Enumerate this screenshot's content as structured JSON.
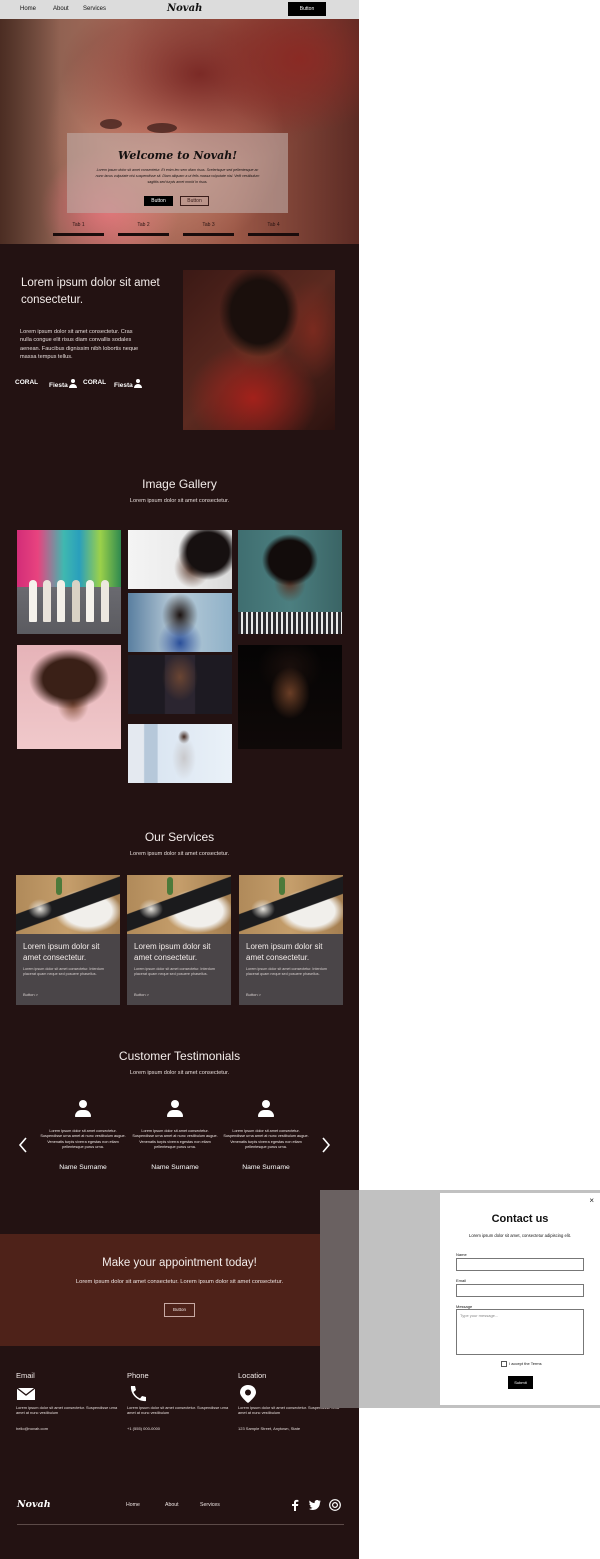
{
  "nav": {
    "links": [
      "Home",
      "About",
      "Services"
    ],
    "logo": "Novah",
    "button": "Button"
  },
  "hero": {
    "title": "Welcome to Novah!",
    "body": "Lorem ipsum dolor sit amet consectetur. Et enim leo sem diam risus. Scelerisque sed pellentesque ac nunc lacus vulputate nisi suspendisse sit. Diam aliquam a ut felis massa vulputate nisi. Velit vestibulum sagittis sed turpis amet morbi in risus.",
    "button_primary": "Button",
    "button_secondary": "Button",
    "tabs": [
      "Tab 1",
      "Tab 2",
      "Tab 3",
      "Tab 4"
    ]
  },
  "intro": {
    "title": "Lorem ipsum dolor sit amet consectetur.",
    "body": "Lorem ipsum dolor sit amet consectetur. Cras nulla congue elit risus diam convallis sodales aenean. Faucibus dignissim nibh lobortis neque massa tempus tellus.",
    "chips": [
      "CORAL",
      "Fiesta",
      "CORAL",
      "Fiesta"
    ]
  },
  "gallery": {
    "title": "Image Gallery",
    "subtitle": "Lorem ipsum dolor sit amet consectetur."
  },
  "services": {
    "title": "Our Services",
    "subtitle": "Lorem ipsum dolor sit amet consectetur.",
    "cards": [
      {
        "title": "Lorem ipsum dolor sit amet consectetur.",
        "body": "Lorem ipsum dolor sit amet consectetur. Interdum placerat quam neque sed posuere phasellus.",
        "link": "Button >"
      },
      {
        "title": "Lorem ipsum dolor sit amet consectetur.",
        "body": "Lorem ipsum dolor sit amet consectetur. Interdum placerat quam neque sed posuere phasellus.",
        "link": "Button >"
      },
      {
        "title": "Lorem ipsum dolor sit amet consectetur.",
        "body": "Lorem ipsum dolor sit amet consectetur. Interdum placerat quam neque sed posuere phasellus.",
        "link": "Button >"
      }
    ]
  },
  "testimonials": {
    "title": "Customer Testimonials",
    "subtitle": "Lorem ipsum dolor sit amet consectetur.",
    "items": [
      {
        "quote": "Lorem ipsum dolor sit amet consectetur. Suspendisse urna amet at nunc vestibulum augue. Venenatis turpis viverra egestas non etiam pellentesque purus urna.",
        "name": "Name Surname"
      },
      {
        "quote": "Lorem ipsum dolor sit amet consectetur. Suspendisse urna amet at nunc vestibulum augue. Venenatis turpis viverra egestas non etiam pellentesque purus urna.",
        "name": "Name Surname"
      },
      {
        "quote": "Lorem ipsum dolor sit amet consectetur. Suspendisse urna amet at nunc vestibulum augue. Venenatis turpis viverra egestas non etiam pellentesque purus urna.",
        "name": "Name Surname"
      }
    ]
  },
  "appointment": {
    "title": "Make your appointment today!",
    "body": "Lorem ipsum dolor sit amet consectetur. Lorem ipsum dolor sit amet consectetur.",
    "button": "Button"
  },
  "contact_info": [
    {
      "label": "Email",
      "icon": "envelope-icon",
      "body": "Lorem ipsum dolor sit amet consectetur. Suspendisse urna amet at nunc vestibulum",
      "value": "hello@novah.com"
    },
    {
      "label": "Phone",
      "icon": "phone-icon",
      "body": "Lorem ipsum dolor sit amet consectetur. Suspendisse urna amet at nunc vestibulum",
      "value": "+1 (555) 000-0000"
    },
    {
      "label": "Location",
      "icon": "map-pin-icon",
      "body": "Lorem ipsum dolor sit amet consectetur. Suspendisse urna amet at nunc vestibulum",
      "value": "123 Sample Street, Anytown, State"
    }
  ],
  "footer": {
    "logo": "Novah",
    "links": [
      "Home",
      "About",
      "Services"
    ],
    "social": [
      "facebook-icon",
      "twitter-icon",
      "instagram-icon"
    ]
  },
  "modal": {
    "title": "Contact us",
    "subtitle": "Lorem ipsum dolor sit amet, consectetur adipiscing elit.",
    "name_label": "Name",
    "email_label": "Email",
    "message_label": "Message",
    "message_placeholder": "Type your message...",
    "checkbox_label": "I accept the Terms",
    "submit": "Submit",
    "close": "×"
  },
  "colors": {
    "page_bg": "#231212",
    "appointment_bg": "#4e2219",
    "card_bg": "#4a4548",
    "nav_bg": "#dcdcdc",
    "overlay_bg": "#c1c1c1"
  }
}
